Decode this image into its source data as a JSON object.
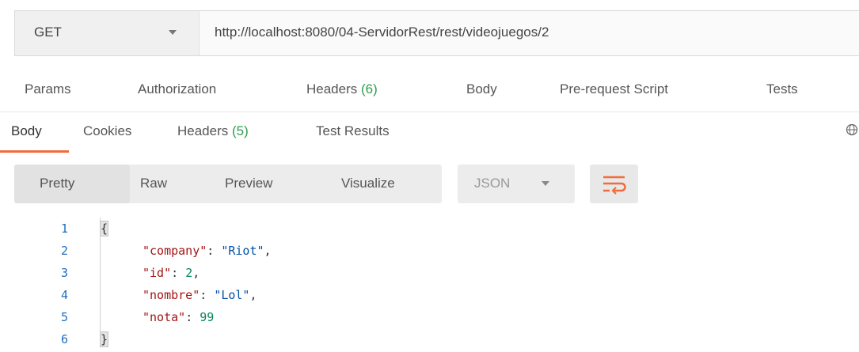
{
  "request": {
    "method": "GET",
    "url": "http://localhost:8080/04-ServidorRest/rest/videojuegos/2"
  },
  "request_tabs": {
    "params": "Params",
    "authorization": "Authorization",
    "headers": "Headers",
    "headers_count": "(6)",
    "body": "Body",
    "prerequest": "Pre-request Script",
    "tests": "Tests"
  },
  "response_tabs": {
    "body": "Body",
    "cookies": "Cookies",
    "headers": "Headers",
    "headers_count": "(5)",
    "test_results": "Test Results",
    "active": "Body"
  },
  "view_modes": {
    "pretty": "Pretty",
    "raw": "Raw",
    "preview": "Preview",
    "visualize": "Visualize",
    "selected": "Pretty"
  },
  "format": "JSON",
  "code": {
    "line_numbers": [
      "1",
      "2",
      "3",
      "4",
      "5",
      "6"
    ],
    "open_brace": "{",
    "close_brace": "}",
    "fields": [
      {
        "key": "\"company\"",
        "value": "\"Riot\"",
        "sep": ","
      },
      {
        "key": "\"id\"",
        "value": "2",
        "sep": ","
      },
      {
        "key": "\"nombre\"",
        "value": "\"Lol\"",
        "sep": ","
      },
      {
        "key": "\"nota\"",
        "value": "99",
        "sep": ""
      }
    ]
  },
  "colors": {
    "accent": "#f26b3a",
    "count_green": "#2e9e4e",
    "json_key": "#a31515",
    "json_string": "#0451a5",
    "json_number": "#098658",
    "line_number": "#1f6dbf"
  }
}
